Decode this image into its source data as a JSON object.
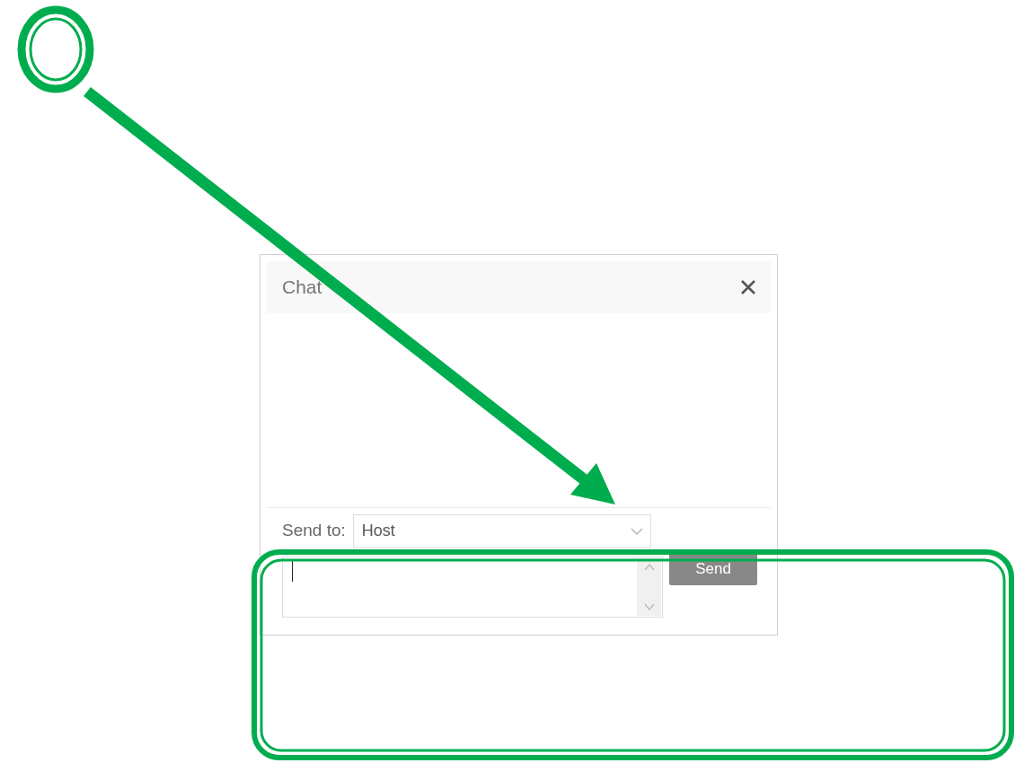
{
  "dialog": {
    "title": "Chat"
  },
  "send_to": {
    "label": "Send to:",
    "value": "Host"
  },
  "send_button": "Send"
}
